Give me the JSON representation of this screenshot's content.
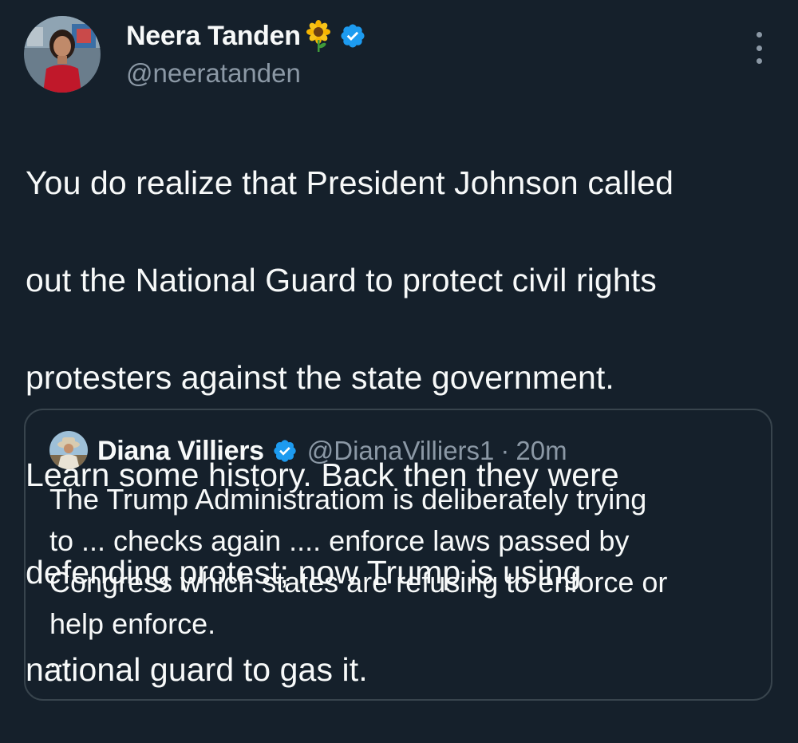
{
  "author": {
    "name": "Neera Tanden",
    "emoji": "🌻",
    "handle": "@neeratanden",
    "verified": true
  },
  "tweet": {
    "lines": [
      "You do realize that President Johnson called",
      "out the National Guard to protect civil rights",
      "protesters against the state government.",
      "Learn some history.  Back then they were",
      "defending protest; now Trump is using",
      "national guard to gas it."
    ]
  },
  "quoted_tweet": {
    "name": "Diana Villiers",
    "verified": true,
    "handle": "@DianaVilliers1",
    "separator": "·",
    "time": "20m",
    "lines": [
      "The Trump Administratiom is deliberately trying",
      "to ... checks again .... enforce laws passed by",
      "Congress which states are refusing to enforce or",
      "help enforce."
    ],
    "more": "..."
  },
  "colors": {
    "background": "#15202b",
    "text": "#f7f9f9",
    "secondary": "#8b98a5",
    "verified_blue": "#1d9bf0",
    "border": "#38444d"
  },
  "icons": {
    "verified": "verified-badge-icon",
    "more": "more-vertical-icon"
  }
}
